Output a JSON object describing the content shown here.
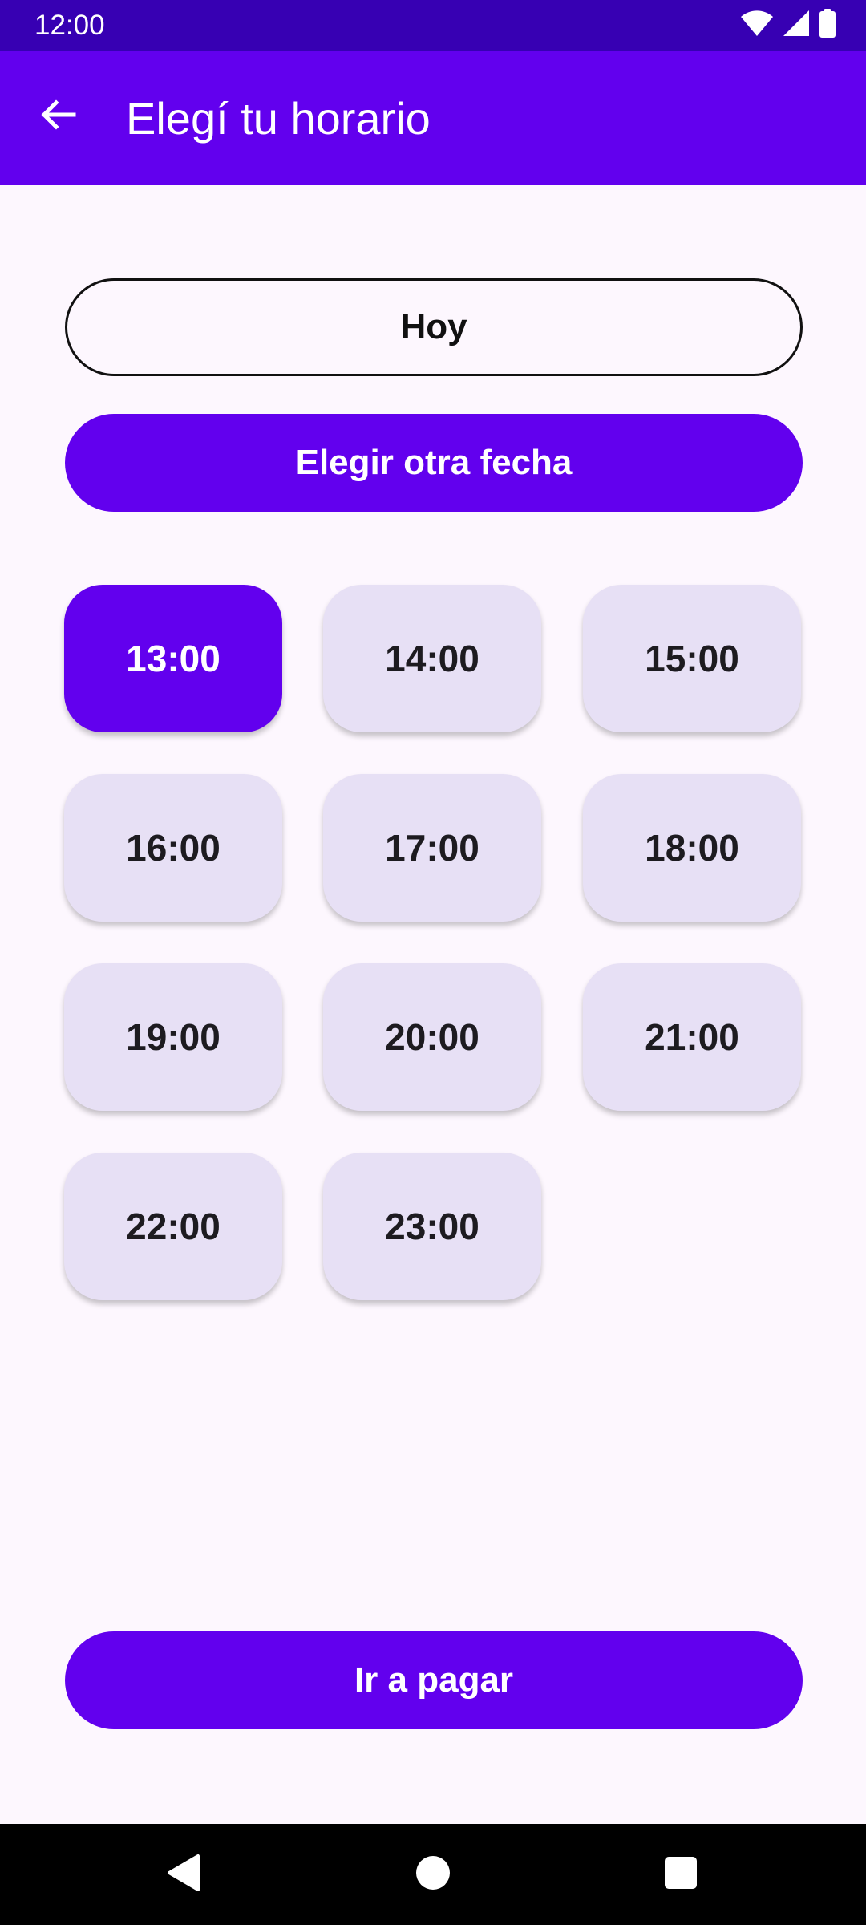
{
  "status_bar": {
    "time": "12:00",
    "icons": [
      "wifi-icon",
      "cell-signal-icon",
      "battery-icon"
    ]
  },
  "app_bar": {
    "title": "Elegí tu horario",
    "back_icon": "arrow-back-icon"
  },
  "date_selector": {
    "today_label": "Hoy",
    "other_date_label": "Elegir otra fecha"
  },
  "time_slots": {
    "selected": "13:00",
    "items": [
      "13:00",
      "14:00",
      "15:00",
      "16:00",
      "17:00",
      "18:00",
      "19:00",
      "20:00",
      "21:00",
      "22:00",
      "23:00"
    ]
  },
  "footer": {
    "pay_label": "Ir a pagar"
  },
  "nav_bar": {
    "icons": [
      "nav-back-icon",
      "nav-home-icon",
      "nav-recents-icon"
    ]
  },
  "colors": {
    "primary": "#6200ee",
    "status_bar": "#3700b3",
    "slot_background": "#e7e0f5",
    "page_background": "#fdf7fe"
  }
}
